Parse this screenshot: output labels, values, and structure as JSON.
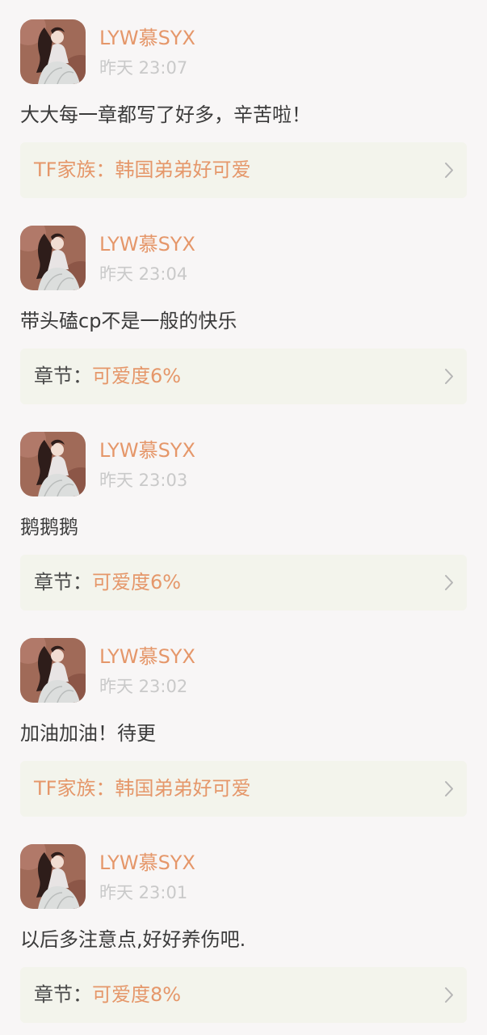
{
  "comments": [
    {
      "username": "LYW慕SYX",
      "timestamp": "昨天 23:07",
      "text": "大大每一章都写了好多，辛苦啦！",
      "ref": {
        "label": "TF家族：",
        "value": "韩国弟弟好可爱",
        "type": "novel"
      }
    },
    {
      "username": "LYW慕SYX",
      "timestamp": "昨天 23:04",
      "text": "带头磕cp不是一般的快乐",
      "ref": {
        "label": "章节：",
        "value": "可爱度6%",
        "type": "chapter"
      }
    },
    {
      "username": "LYW慕SYX",
      "timestamp": "昨天 23:03",
      "text": "鹅鹅鹅",
      "ref": {
        "label": "章节：",
        "value": "可爱度6%",
        "type": "chapter"
      }
    },
    {
      "username": "LYW慕SYX",
      "timestamp": "昨天 23:02",
      "text": "加油加油！待更",
      "ref": {
        "label": "TF家族：",
        "value": "韩国弟弟好可爱",
        "type": "novel"
      }
    },
    {
      "username": "LYW慕SYX",
      "timestamp": "昨天 23:01",
      "text": "以后多注意点,好好养伤吧.",
      "ref": {
        "label": "章节：",
        "value": "可爱度8%",
        "type": "chapter"
      }
    }
  ],
  "icons": {
    "avatar": "avatar-portrait",
    "ref_arrow": "chevron-right-icon"
  },
  "colors": {
    "background": "#f8f6f6",
    "username": "#e5976a",
    "accent": "#e5976a",
    "timestamp": "#c9c9c9",
    "text": "#3b3b3b",
    "card": "#f3f4ec"
  }
}
